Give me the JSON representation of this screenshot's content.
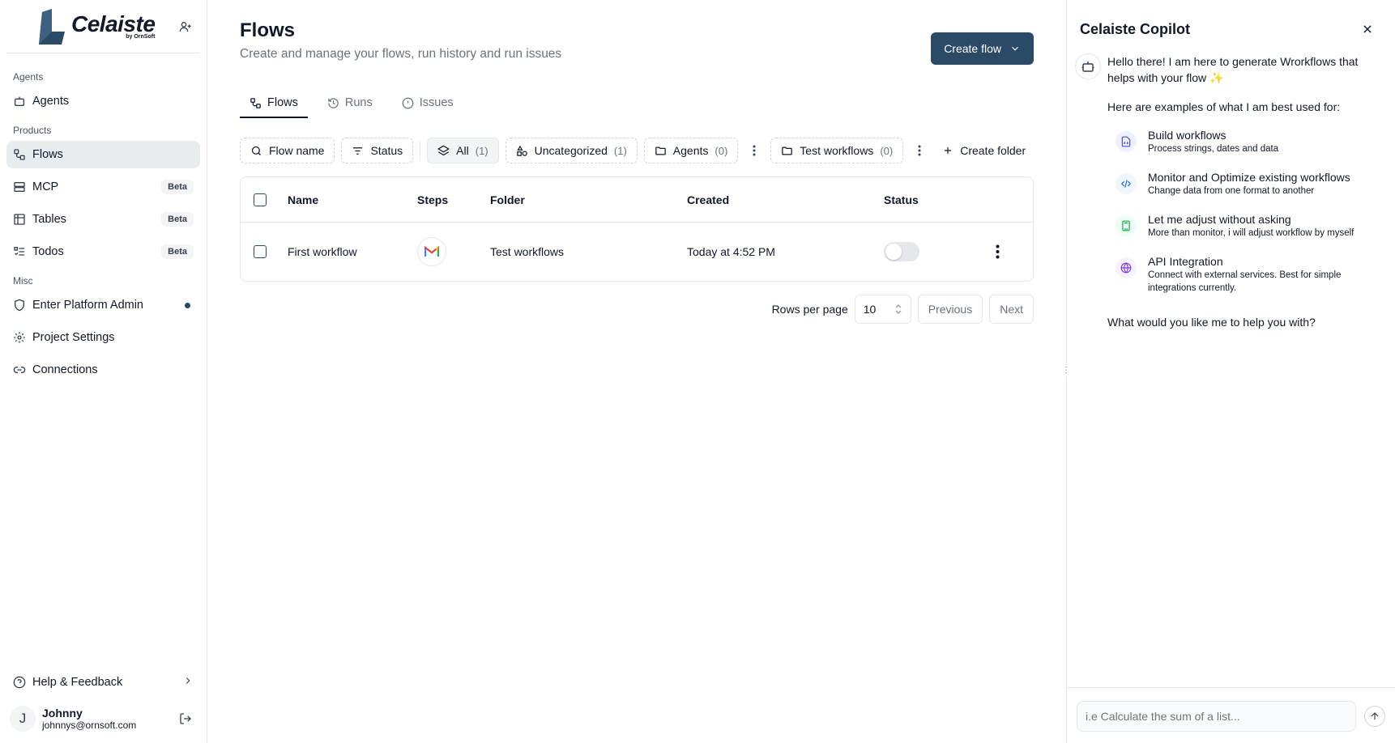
{
  "brand": {
    "name": "Celaiste",
    "sub": "by OrnSoft"
  },
  "sidebar": {
    "sections": [
      {
        "label": "Agents",
        "items": [
          {
            "label": "Agents",
            "icon": "bot-icon"
          }
        ]
      },
      {
        "label": "Products",
        "items": [
          {
            "label": "Flows",
            "icon": "workflow-icon",
            "active": true
          },
          {
            "label": "MCP",
            "icon": "server-icon",
            "badge": "Beta"
          },
          {
            "label": "Tables",
            "icon": "table-icon",
            "badge": "Beta"
          },
          {
            "label": "Todos",
            "icon": "list-todo-icon",
            "badge": "Beta"
          }
        ]
      },
      {
        "label": "Misc",
        "items": [
          {
            "label": "Enter Platform Admin",
            "icon": "shield-icon"
          },
          {
            "label": "Project Settings",
            "icon": "gear-icon"
          },
          {
            "label": "Connections",
            "icon": "link-icon"
          }
        ]
      }
    ],
    "help": "Help & Feedback",
    "user": {
      "initial": "J",
      "name": "Johnny",
      "email": "johnnys@ornsoft.com"
    }
  },
  "header": {
    "title": "Flows",
    "subtitle": "Create and manage your flows, run history and run issues",
    "create_label": "Create flow"
  },
  "tabs": [
    "Flows",
    "Runs",
    "Issues"
  ],
  "filters": {
    "search": "Flow name",
    "status": "Status",
    "folders": [
      {
        "label": "All",
        "count": "(1)"
      },
      {
        "label": "Uncategorized",
        "count": "(1)"
      },
      {
        "label": "Agents",
        "count": "(0)"
      },
      {
        "label": "Test workflows",
        "count": "(0)"
      }
    ],
    "create_folder": "Create folder"
  },
  "table": {
    "columns": [
      "Name",
      "Steps",
      "Folder",
      "Created",
      "Status"
    ],
    "rows": [
      {
        "name": "First workflow",
        "step_icon": "gmail-icon",
        "folder": "Test workflows",
        "created": "Today at 4:52 PM",
        "enabled": false
      }
    ]
  },
  "pagination": {
    "rows_label": "Rows per page",
    "rows_value": "10",
    "prev": "Previous",
    "next": "Next"
  },
  "copilot": {
    "title": "Celaiste Copilot",
    "greeting": "Hello there! I am here to generate Wrorkflows that helps with your flow ✨",
    "examples_intro": "Here are examples of what I am best used for:",
    "examples": [
      {
        "title": "Build workflows",
        "desc": "Process strings, dates and data",
        "color": "#eef2ff",
        "icon_color": "#4f46e5"
      },
      {
        "title": "Monitor and Optimize existing workflows",
        "desc": "Change data from one format to another",
        "color": "#eff6ff",
        "icon_color": "#2563eb"
      },
      {
        "title": "Let me adjust without asking",
        "desc": "More than monitor, i will adjust workflow by myself",
        "color": "#ecfdf5",
        "icon_color": "#16a34a"
      },
      {
        "title": "API Integration",
        "desc": "Connect with external services. Best for simple integrations currently.",
        "color": "#f5f3ff",
        "icon_color": "#7c3aed"
      }
    ],
    "question": "What would you like me to help you with?",
    "input_placeholder": "i.e Calculate the sum of a list..."
  },
  "colors": {
    "primary": "#2b4a66",
    "active_nav": "#eaedf0"
  }
}
